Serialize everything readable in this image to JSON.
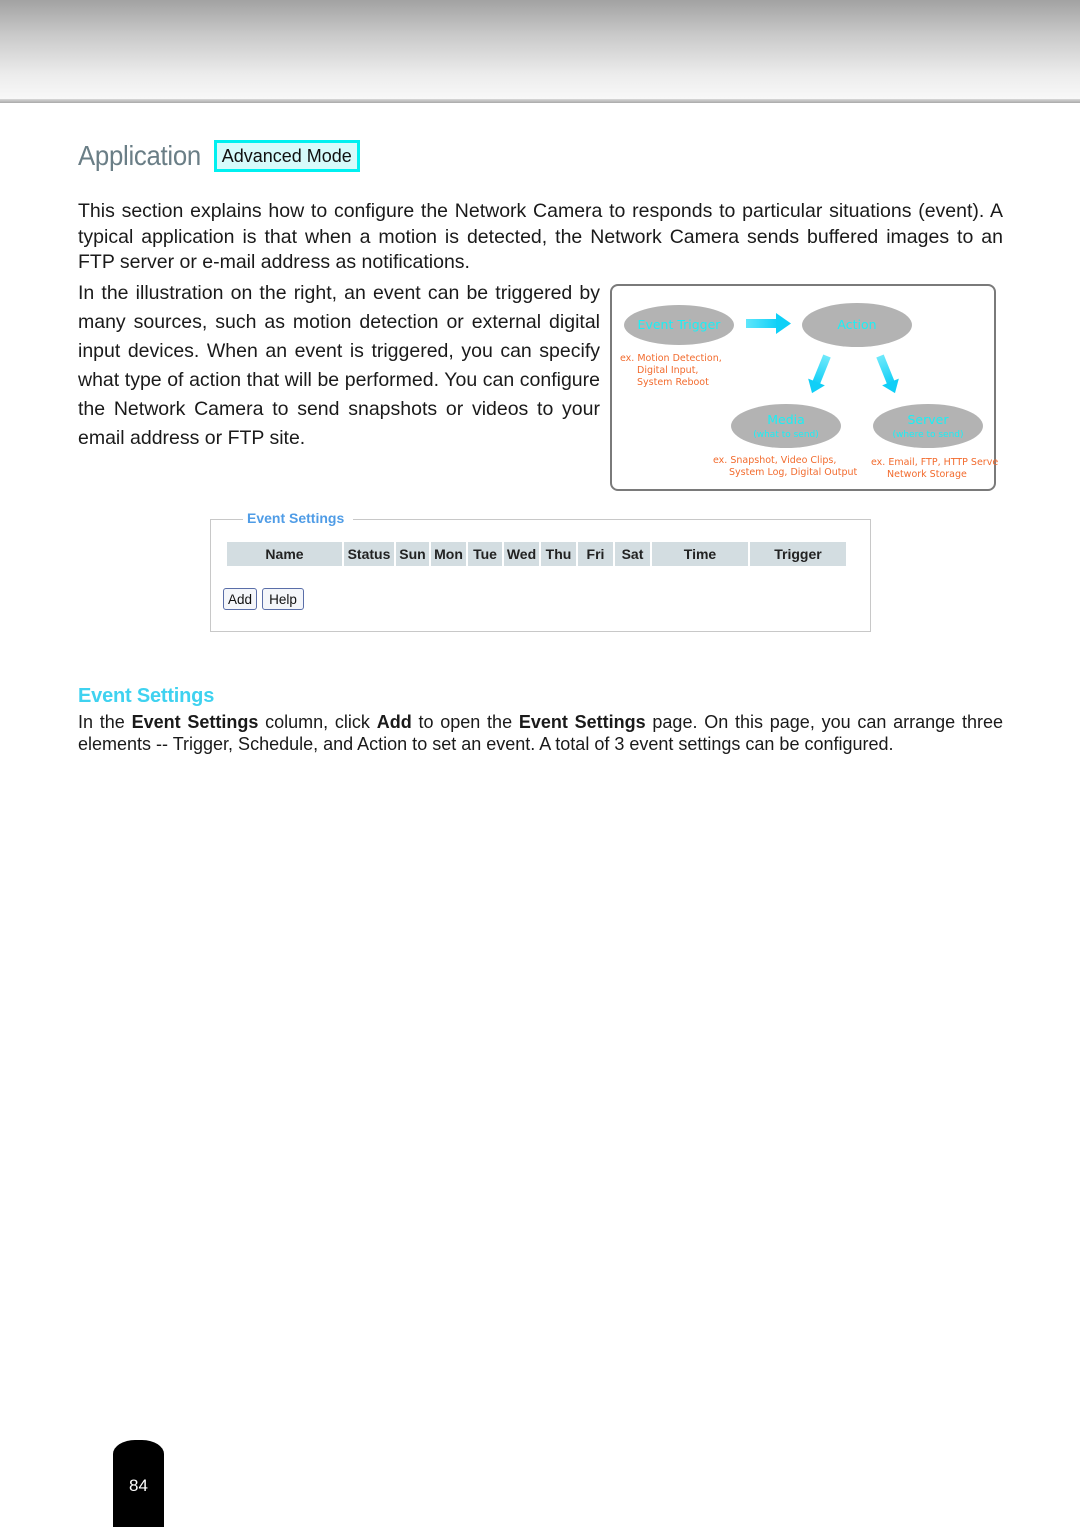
{
  "header": {
    "title": "Application",
    "mode_badge": "Advanced Mode"
  },
  "intro": "This section explains how to configure the Network Camera to responds to particular situations (event). A typical application is that when a motion is detected, the Network Camera sends buffered images to an FTP server or e-mail address as notifications.",
  "illustration_text": "In the illustration on the right, an event can be triggered by many sources, such as motion detection or external digital input devices. When an event is triggered, you can specify what type of action that will be performed. You can configure the Network Camera to send snapshots or videos to your email address or FTP site.",
  "diagram": {
    "nodes": {
      "event_trigger": "Event Trigger",
      "action": "Action",
      "media": "Media",
      "media_sub": "(what to send)",
      "server": "Server",
      "server_sub": "(where to send)"
    },
    "examples": {
      "trigger": [
        "ex. Motion Detection,",
        "Digital Input,",
        "System Reboot"
      ],
      "media": [
        "ex. Snapshot, Video Clips,",
        "System Log, Digital Output"
      ],
      "server": [
        "ex. Email, FTP, HTTP Server,",
        "Network Storage"
      ]
    },
    "colors": {
      "oval": "#b3b3b3",
      "label": "#19f0f6",
      "arrow": "#18d9f8",
      "example_text": "#f26b2e"
    }
  },
  "event_settings_panel": {
    "legend": "Event Settings",
    "columns": [
      "Name",
      "Status",
      "Sun",
      "Mon",
      "Tue",
      "Wed",
      "Thu",
      "Fri",
      "Sat",
      "Time",
      "Trigger"
    ],
    "add_button": "Add",
    "help_button": "Help"
  },
  "section": {
    "heading": "Event Settings",
    "body_parts": {
      "p1": "In the ",
      "b1": "Event Settings",
      "p2": " column, click ",
      "b2": "Add",
      "p3": " to open the ",
      "b3": "Event Settings",
      "p4": " page. On this page, you can arrange three elements -- Trigger, Schedule, and Action to set an event. A total of 3 event settings can be configured."
    }
  },
  "page_number": "84"
}
